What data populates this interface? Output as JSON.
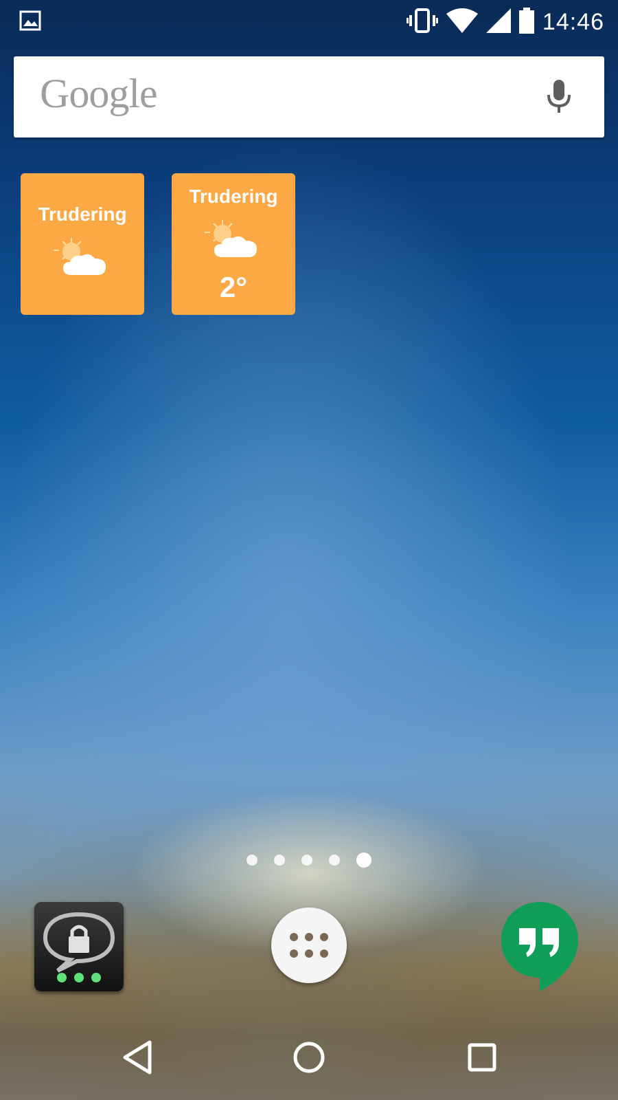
{
  "status_bar": {
    "time": "14:46",
    "icons": [
      "image-notification-icon",
      "vibrate-icon",
      "wifi-icon",
      "signal-icon",
      "battery-icon"
    ]
  },
  "search": {
    "logo_text": "Google",
    "mic_icon": "mic-icon"
  },
  "widgets": [
    {
      "city": "Trudering",
      "condition": "partly-cloudy",
      "temp": ""
    },
    {
      "city": "Trudering",
      "condition": "partly-cloudy",
      "temp": "2°"
    }
  ],
  "page_indicator": {
    "pages": 5,
    "active": 5
  },
  "dock": [
    {
      "app": "secure-chat-app",
      "icon": "lock-chat-icon"
    },
    {
      "app": "app-drawer",
      "icon": "apps-grid-icon"
    },
    {
      "app": "hangouts-app",
      "icon": "hangouts-icon"
    }
  ],
  "nav": [
    "back-icon",
    "home-icon",
    "recents-icon"
  ],
  "colors": {
    "widget": "#fca845",
    "hangouts": "#0f9d58"
  }
}
